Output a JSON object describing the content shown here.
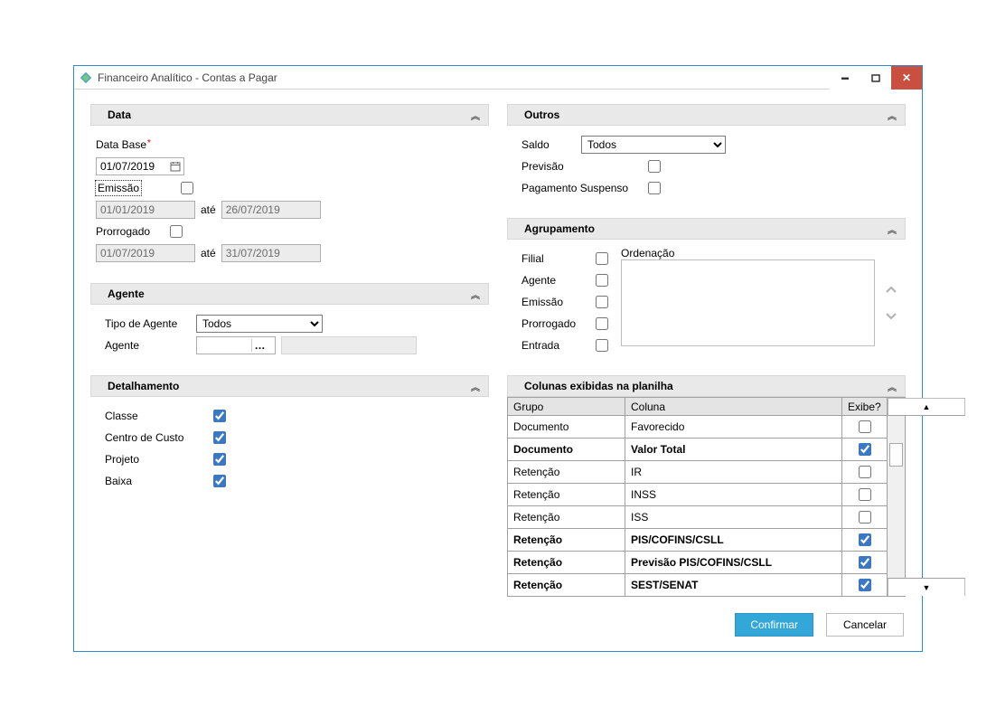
{
  "window": {
    "title": "Financeiro Analítico - Contas a Pagar"
  },
  "data_panel": {
    "title": "Data",
    "data_base_label": "Data Base",
    "data_base_value": "01/07/2019",
    "emissao_label": "Emissão",
    "emissao_checked": false,
    "emissao_from": "01/01/2019",
    "emissao_to": "26/07/2019",
    "ate_label": "até",
    "prorrogado_label": "Prorrogado",
    "prorrogado_checked": false,
    "prorrogado_from": "01/07/2019",
    "prorrogado_to": "31/07/2019"
  },
  "agente_panel": {
    "title": "Agente",
    "tipo_label": "Tipo de Agente",
    "tipo_value": "Todos",
    "agente_label": "Agente",
    "agente_value": ""
  },
  "detalhamento_panel": {
    "title": "Detalhamento",
    "items": [
      {
        "label": "Classe",
        "checked": true
      },
      {
        "label": "Centro de Custo",
        "checked": true
      },
      {
        "label": "Projeto",
        "checked": true
      },
      {
        "label": "Baixa",
        "checked": true
      }
    ]
  },
  "outros_panel": {
    "title": "Outros",
    "saldo_label": "Saldo",
    "saldo_value": "Todos",
    "previsao_label": "Previsão",
    "previsao_checked": false,
    "pag_susp_label": "Pagamento Suspenso",
    "pag_susp_checked": false
  },
  "agrupamento_panel": {
    "title": "Agrupamento",
    "ordenacao_label": "Ordenação",
    "items": [
      {
        "label": "Filial",
        "checked": false
      },
      {
        "label": "Agente",
        "checked": false
      },
      {
        "label": "Emissão",
        "checked": false
      },
      {
        "label": "Prorrogado",
        "checked": false
      },
      {
        "label": "Entrada",
        "checked": false
      }
    ]
  },
  "colunas_panel": {
    "title": "Colunas exibidas na planilha",
    "headers": {
      "grupo": "Grupo",
      "coluna": "Coluna",
      "exibe": "Exibe?"
    },
    "rows": [
      {
        "grupo": "Documento",
        "coluna": "Favorecido",
        "exibe": false,
        "bold": false
      },
      {
        "grupo": "Documento",
        "coluna": "Valor Total",
        "exibe": true,
        "bold": true
      },
      {
        "grupo": "Retenção",
        "coluna": "IR",
        "exibe": false,
        "bold": false
      },
      {
        "grupo": "Retenção",
        "coluna": "INSS",
        "exibe": false,
        "bold": false
      },
      {
        "grupo": "Retenção",
        "coluna": "ISS",
        "exibe": false,
        "bold": false
      },
      {
        "grupo": "Retenção",
        "coluna": "PIS/COFINS/CSLL",
        "exibe": true,
        "bold": true
      },
      {
        "grupo": "Retenção",
        "coluna": "Previsão PIS/COFINS/CSLL",
        "exibe": true,
        "bold": true
      },
      {
        "grupo": "Retenção",
        "coluna": "SEST/SENAT",
        "exibe": true,
        "bold": true
      }
    ]
  },
  "footer": {
    "confirm": "Confirmar",
    "cancel": "Cancelar"
  }
}
